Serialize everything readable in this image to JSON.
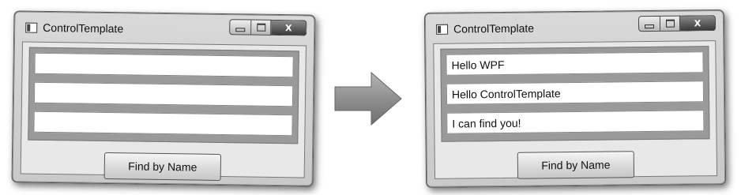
{
  "before_window": {
    "title": "ControlTemplate",
    "close_glyph": "X",
    "textboxes": [
      "",
      "",
      ""
    ],
    "button_label": "Find by Name"
  },
  "after_window": {
    "title": "ControlTemplate",
    "close_glyph": "X",
    "textboxes": [
      "Hello WPF",
      "Hello ControlTemplate",
      "I can find you!"
    ],
    "button_label": "Find by Name"
  },
  "arrow": {
    "icon": "right-arrow-icon",
    "color": "#8f8f8f"
  }
}
